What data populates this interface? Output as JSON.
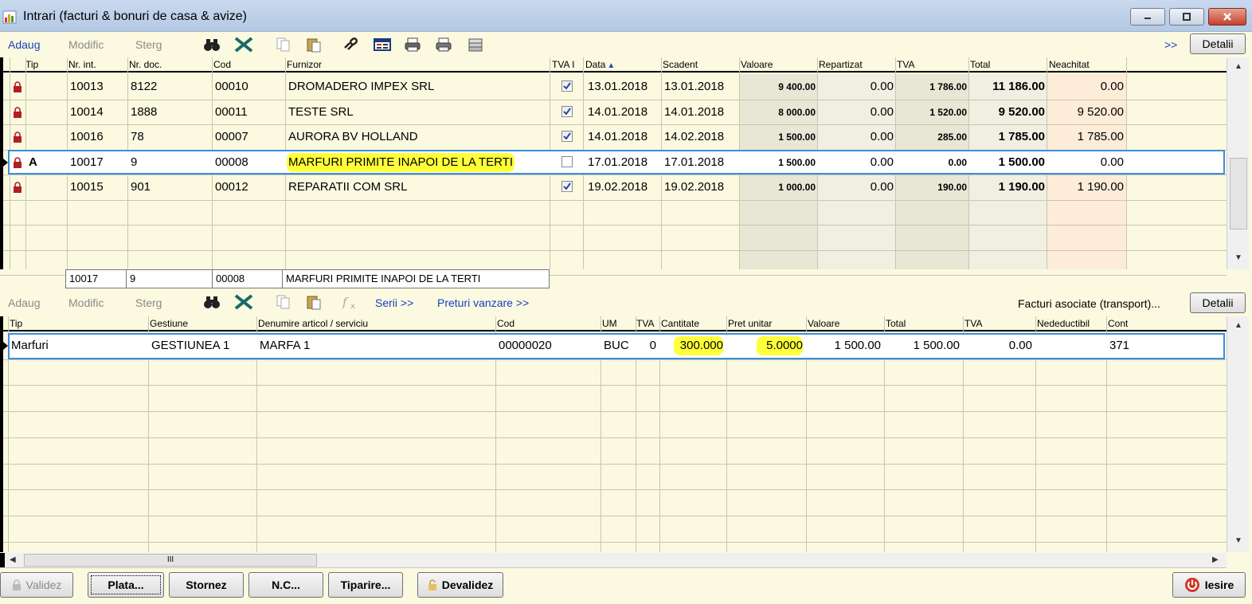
{
  "window": {
    "title": "Intrari (facturi & bonuri de casa & avize)"
  },
  "top_toolbar": {
    "add": "Adaug",
    "modify": "Modific",
    "delete": "Sterg",
    "more": ">>",
    "details": "Detalii",
    "icons": [
      "binoculars-icon",
      "excel-icon",
      "copy-icon",
      "paste-icon",
      "link-icon",
      "table-icon",
      "print-icon",
      "print-preview-icon",
      "export-icon"
    ]
  },
  "invoices": {
    "columns": [
      "Tip",
      "Nr. int.",
      "Nr. doc.",
      "Cod",
      "Furnizor",
      "TVA I",
      "Data",
      "Scadent",
      "Valoare",
      "Repartizat",
      "TVA",
      "Total",
      "Neachitat"
    ],
    "sort_indicator": "▲",
    "rows": [
      {
        "tip": "",
        "nr_int": "10013",
        "nr_doc": "8122",
        "cod": "00010",
        "furnizor": "DROMADERO IMPEX SRL",
        "tva_i": true,
        "data": "13.01.2018",
        "scadent": "13.01.2018",
        "valoare": "9 400.00",
        "repartizat": "0.00",
        "tva": "1 786.00",
        "total": "11 186.00",
        "neachitat": "0.00"
      },
      {
        "tip": "",
        "nr_int": "10014",
        "nr_doc": "1888",
        "cod": "00011",
        "furnizor": "TESTE SRL",
        "tva_i": true,
        "data": "14.01.2018",
        "scadent": "14.01.2018",
        "valoare": "8 000.00",
        "repartizat": "0.00",
        "tva": "1 520.00",
        "total": "9 520.00",
        "neachitat": "9 520.00"
      },
      {
        "tip": "",
        "nr_int": "10016",
        "nr_doc": "78",
        "cod": "00007",
        "furnizor": "AURORA BV HOLLAND",
        "tva_i": true,
        "data": "14.01.2018",
        "scadent": "14.02.2018",
        "valoare": "1 500.00",
        "repartizat": "0.00",
        "tva": "285.00",
        "total": "1 785.00",
        "neachitat": "1 785.00"
      },
      {
        "tip": "A",
        "nr_int": "10017",
        "nr_doc": "9",
        "cod": "00008",
        "furnizor": "MARFURI PRIMITE INAPOI DE LA TERTI",
        "tva_i": false,
        "data": "17.01.2018",
        "scadent": "17.01.2018",
        "valoare": "1 500.00",
        "repartizat": "0.00",
        "tva": "0.00",
        "total": "1 500.00",
        "neachitat": "0.00"
      },
      {
        "tip": "",
        "nr_int": "10015",
        "nr_doc": "901",
        "cod": "00012",
        "furnizor": "REPARATII COM SRL",
        "tva_i": true,
        "data": "19.02.2018",
        "scadent": "19.02.2018",
        "valoare": "1 000.00",
        "repartizat": "0.00",
        "tva": "190.00",
        "total": "1 190.00",
        "neachitat": "1 190.00"
      }
    ],
    "selected_index": 3
  },
  "summary": {
    "nr_int": "10017",
    "nr_doc": "9",
    "cod": "00008",
    "furnizor": "MARFURI PRIMITE INAPOI DE LA TERTI"
  },
  "detail_toolbar": {
    "add": "Adaug",
    "modify": "Modific",
    "delete": "Sterg",
    "series": "Serii >>",
    "sale_prices": "Preturi vanzare >>",
    "associated": "Facturi asociate (transport)...",
    "details": "Detalii"
  },
  "lines": {
    "columns": [
      "Tip",
      "Gestiune",
      "Denumire articol / serviciu",
      "Cod",
      "UM",
      "TVA",
      "Cantitate",
      "Pret unitar",
      "Valoare",
      "Total",
      "TVA",
      "Nedeductibil",
      "Cont"
    ],
    "rows": [
      {
        "tip": "Marfuri",
        "gestiune": "GESTIUNEA 1",
        "denumire": "MARFA 1",
        "cod": "00000020",
        "um": "BUC",
        "tva": "0",
        "cantitate": "300.000",
        "pret": "5.0000",
        "valoare": "1 500.00",
        "total": "1 500.00",
        "tva_val": "0.00",
        "nedeductibil": "",
        "cont": "371"
      }
    ]
  },
  "scrollbar": {
    "thumb_marker": "III"
  },
  "bottom_buttons": {
    "validate": "Validez",
    "pay": "Plata...",
    "reverse": "Stornez",
    "credit_note": "N.C...",
    "print": "Tiparire...",
    "invalidate": "Devalidez",
    "exit": "Iesire"
  }
}
